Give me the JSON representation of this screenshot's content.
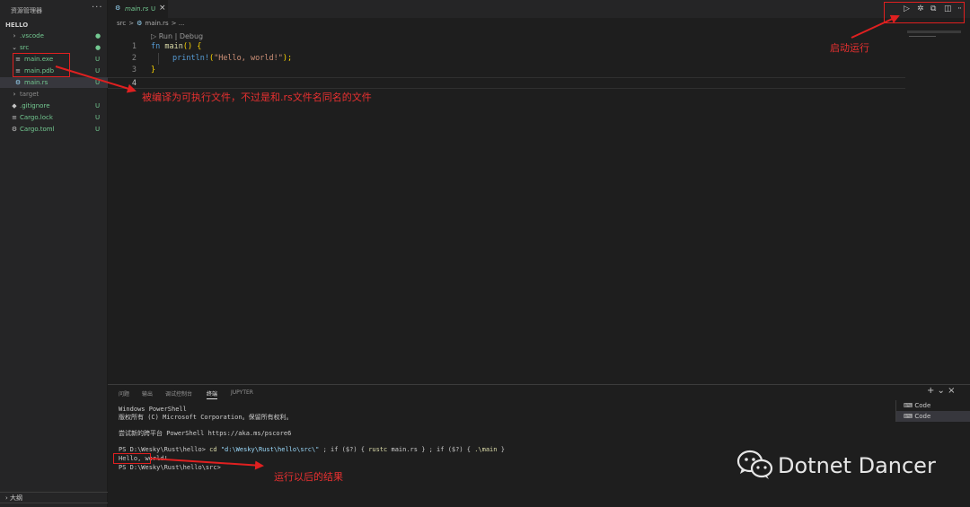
{
  "sidebar": {
    "title": "资源管理器",
    "more": "···",
    "root": "HELLO",
    "items": [
      {
        "label": ".vscode",
        "status": "●",
        "icon": "chevron-right"
      },
      {
        "label": "src",
        "status": "●",
        "icon": "chevron-down"
      },
      {
        "label": "main.exe",
        "status": "U",
        "icon": "file-lines"
      },
      {
        "label": "main.pdb",
        "status": "U",
        "icon": "file-lines"
      },
      {
        "label": "main.rs",
        "status": "U",
        "icon": "rust-gear"
      },
      {
        "label": "target",
        "status": "",
        "icon": "chevron-right"
      },
      {
        "label": ".gitignore",
        "status": "U",
        "icon": "diamond"
      },
      {
        "label": "Cargo.lock",
        "status": "U",
        "icon": "file-lines"
      },
      {
        "label": "Cargo.toml",
        "status": "U",
        "icon": "gear"
      }
    ],
    "outline": "大纲"
  },
  "tab": {
    "name": "main.rs",
    "status": "U",
    "close": "×"
  },
  "breadcrumb": {
    "folder": "src",
    "sep": ">",
    "file": "main.rs",
    "more": "> ..."
  },
  "codelens": "▷ Run | Debug",
  "code": {
    "line_numbers": [
      "1",
      "2",
      "3",
      "4"
    ],
    "l1_kw": "fn",
    "l1_fn": "main",
    "l1_rest": "() {",
    "l2_macro": "println!",
    "l2_str": "\"Hello, world!\"",
    "l2_paren_open": "(",
    "l2_end": ");",
    "l3": "}"
  },
  "panel": {
    "tabs": [
      "问题",
      "输出",
      "调试控制台",
      "终端",
      "JUPYTER"
    ],
    "active_tab": "终端",
    "actions": "+ ⌄ ×",
    "terminals": [
      "Code",
      "Code"
    ],
    "terminal_lines": {
      "l1": "Windows PowerShell",
      "l2": "版权所有 (C) Microsoft Corporation。保留所有权利。",
      "l3": "尝试新的跨平台 PowerShell https://aka.ms/pscore6",
      "prompt1": "PS D:\\Wesky\\Rust\\hello> ",
      "cmd_cd": "cd",
      "path_cd": "\"d:\\Wesky\\Rust\\hello\\src\\\"",
      "mid1": " ; if ($?) { ",
      "cmd_rustc": "rustc",
      "mid2": " main.rs } ; if ($?) { ",
      "cmd_main": ".\\main",
      "end": " }",
      "output": "Hello, world!",
      "prompt2": "PS D:\\Wesky\\Rust\\hello\\src>"
    }
  },
  "annotations": {
    "compiled": "被编译为可执行文件，不过是和.rs文件名同名的文件",
    "run": "启动运行",
    "result": "运行以后的结果"
  },
  "watermark": "Dotnet Dancer",
  "colors": {
    "accent_red": "#e02020",
    "untracked_green": "#73c991"
  }
}
